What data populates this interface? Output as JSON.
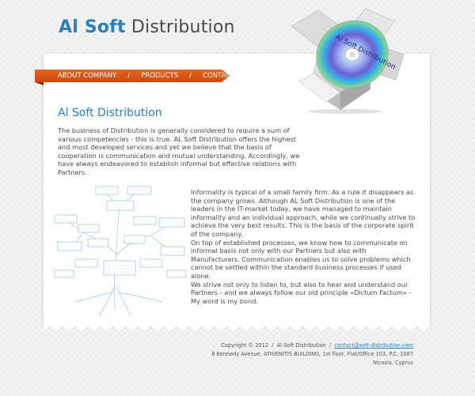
{
  "logo": {
    "part1": "Al Soft",
    "part2": "Distribution"
  },
  "box_label": "Al Soft Distribution",
  "nav": {
    "items": [
      {
        "label": "ABOUT COMPANY"
      },
      {
        "label": "PRODUCTS"
      },
      {
        "label": "CONTACTS"
      }
    ],
    "separator": "/"
  },
  "main": {
    "heading": "Al Soft Distribution",
    "intro": "The business of Distribution is generally considered to require a sum of various competencies - this is true. AL Soft Distribution  offers the highest and most developed services and yet we believe that the basis of cooperation is communication and mutual understanding. Accordingly, we have always endeavored to establish informal but effective relations with Partners.",
    "paragraph1": "Informality is typical of a small family firm. As a rule it disappears as the company grows. Although AL Soft Distribution  is one of the leaders in the IT-market today, we have managed to maintain informality and an individual approach, while we continually strive to achieve the very best results. This is the basis of the corporate spirit of the company.",
    "paragraph2": "On top of established processes, we know how to communicate on informal basis not only with our Partners but also with Manufacturers. Communication enables us to solve problems which cannot be settled within the standard business processes if used alone.",
    "paragraph3": "We strive not only to listen to, but also to hear and understand our Partners - and we always follow our old principle «Dictum Factum» - My word is my bond."
  },
  "footer": {
    "copyright": "Copyright © 2012",
    "company": "Al Soft Distribution",
    "separator": "/",
    "email": "contact@soft-distribution.com",
    "address_line1": "8 Kennedy Avenue, ATHIENITIS BUILDING, 1st floor, Flat/Office 103, P.C. 1087",
    "address_line2": "Nicosia, Cyprus"
  },
  "colors": {
    "brand_blue": "#2b7fc0",
    "nav_orange": "#d9571a",
    "background": "#ededed"
  }
}
